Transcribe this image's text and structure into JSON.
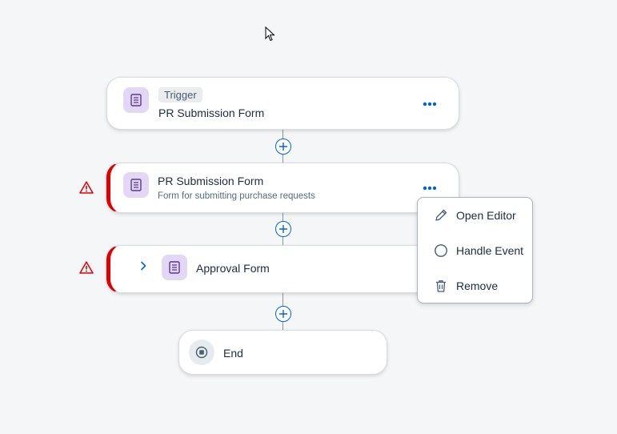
{
  "flow": {
    "trigger": {
      "badge": "Trigger",
      "title": "PR Submission Form",
      "icon": "form-icon"
    },
    "step1": {
      "title": "PR Submission Form",
      "subtitle": "Form for submitting purchase requests",
      "icon": "form-icon",
      "status": "error"
    },
    "step2": {
      "title": "Approval Form",
      "icon": "form-icon",
      "status": "error",
      "expand_icon": "chevron-right-icon"
    },
    "end": {
      "title": "End",
      "icon": "stop-icon"
    }
  },
  "context_menu": {
    "items": [
      {
        "label": "Open Editor",
        "icon": "pencil-icon"
      },
      {
        "label": "Handle Event",
        "icon": "circle-icon"
      },
      {
        "label": "Remove",
        "icon": "trash-icon"
      }
    ]
  },
  "colors": {
    "accent": "#0064d9",
    "error": "#e00000",
    "form_icon_bg": "#e2d8f5",
    "form_icon_fg": "#5d36a5",
    "background": "#f5f6f7"
  }
}
